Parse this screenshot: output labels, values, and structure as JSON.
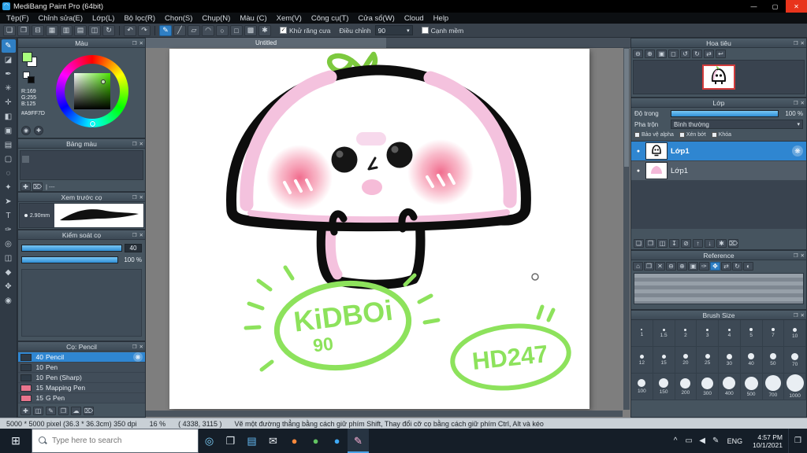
{
  "chrome": {
    "popout_glyph": "❐",
    "close_glyph": "✕",
    "dropdown_glyph": "▾",
    "check_glyph": "✓",
    "eye_glyph": "●",
    "gear_glyph": "❋",
    "accent_color": "#2f86d1"
  },
  "window": {
    "title": "MediBang Paint Pro (64bit)",
    "app_glyph": "◠",
    "minimize_glyph": "—",
    "maximize_glyph": "▢",
    "close_glyph": "✕"
  },
  "menu": {
    "items": [
      "Tệp(F)",
      "Chỉnh sửa(E)",
      "Lớp(L)",
      "Bộ lọc(R)",
      "Chọn(S)",
      "Chụp(N)",
      "Màu (C)",
      "Xem(V)",
      "Công cụ(T)",
      "Cửa sổ(W)",
      "Cloud",
      "Help"
    ]
  },
  "toolbar": {
    "file_icons": [
      {
        "name": "new-canvas-icon",
        "glyph": "❏"
      },
      {
        "name": "open-file-icon",
        "glyph": "❐"
      },
      {
        "name": "save-file-icon",
        "glyph": "⊟"
      },
      {
        "name": "grid-icon",
        "glyph": "▦"
      },
      {
        "name": "pixel-grid-icon",
        "glyph": "▥"
      },
      {
        "name": "material-panel-icon",
        "glyph": "▤"
      },
      {
        "name": "snap-settings-icon",
        "glyph": "◫"
      },
      {
        "name": "rotate-canvas-icon",
        "glyph": "↻"
      }
    ],
    "history_icons": [
      {
        "name": "undo-icon",
        "glyph": "↶"
      },
      {
        "name": "redo-icon",
        "glyph": "↷"
      }
    ],
    "mode_icons": [
      {
        "name": "brush-mode-icon",
        "glyph": "✎",
        "active": true
      },
      {
        "name": "straight-line-icon",
        "glyph": "╱"
      },
      {
        "name": "polyline-icon",
        "glyph": "▱"
      },
      {
        "name": "curve-icon",
        "glyph": "◠"
      },
      {
        "name": "ellipse-icon",
        "glyph": "○"
      },
      {
        "name": "rectangle-icon",
        "glyph": "□"
      },
      {
        "name": "fill-shape-icon",
        "glyph": "▩"
      },
      {
        "name": "stabilizer-icon",
        "glyph": "✱"
      }
    ],
    "antialias_label": "Khử răng cưa",
    "antialias_checked": true,
    "adjust_label": "Điều chỉnh",
    "adjust_value": "90",
    "soft_edge_label": "Cạnh mềm"
  },
  "tools": [
    {
      "name": "brush-tool-icon",
      "glyph": "✎",
      "active": true
    },
    {
      "name": "eraser-tool-icon",
      "glyph": "◪"
    },
    {
      "name": "pen-tool-icon",
      "glyph": "✒"
    },
    {
      "name": "airbrush-tool-icon",
      "glyph": "✳"
    },
    {
      "name": "move-tool-icon",
      "glyph": "✛"
    },
    {
      "name": "fill-tool-icon",
      "glyph": "◧"
    },
    {
      "name": "bucket-tool-icon",
      "glyph": "▣"
    },
    {
      "name": "gradient-tool-icon",
      "glyph": "▤"
    },
    {
      "name": "select-tool-icon",
      "glyph": "▢"
    },
    {
      "name": "lasso-tool-icon",
      "glyph": "◌"
    },
    {
      "name": "magic-wand-tool-icon",
      "glyph": "✦"
    },
    {
      "name": "select-pen-tool-icon",
      "glyph": "➤"
    },
    {
      "name": "text-tool-icon",
      "glyph": "T"
    },
    {
      "name": "eyedropper-tool-icon",
      "glyph": "✑"
    },
    {
      "name": "measure-tool-icon",
      "glyph": "◎"
    },
    {
      "name": "divide-tool-icon",
      "glyph": "◫"
    },
    {
      "name": "material-tool-icon",
      "glyph": "◆"
    },
    {
      "name": "hand-tool-icon",
      "glyph": "✥"
    },
    {
      "name": "zoom-tool-icon",
      "glyph": "◉"
    }
  ],
  "color_panel": {
    "title": "Màu",
    "r_label": "R:169",
    "g_label": "G:255",
    "b_label": "B:125",
    "hex_label": "#A9FF7D",
    "foreground_color": "#a9ff7d",
    "background_color": "#ffffff",
    "picker_icons": [
      {
        "name": "screen-picker-icon",
        "glyph": "◉"
      },
      {
        "name": "add-to-palette-icon",
        "glyph": "✚"
      }
    ]
  },
  "palette_panel": {
    "title": "Bảng màu",
    "footer_label": "| ---",
    "footer_icons": [
      {
        "name": "add-swatch-icon",
        "glyph": "✚"
      },
      {
        "name": "delete-swatch-icon",
        "glyph": "⌦"
      }
    ]
  },
  "brush_preview_panel": {
    "title": "Xem trước cọ",
    "size_label": "2.90mm"
  },
  "brush_control_panel": {
    "title": "Kiểm soát cọ",
    "size_value": "40",
    "opacity_value": "100 %"
  },
  "brush_list_panel": {
    "title": "Cọ: Pencil",
    "brushes": [
      {
        "size": "40",
        "name": "Pencil",
        "selected": true,
        "swatch": "#2f3b47"
      },
      {
        "size": "10",
        "name": "Pen",
        "swatch": "#2f3b47"
      },
      {
        "size": "10",
        "name": "Pen (Sharp)",
        "swatch": "#2f3b47"
      },
      {
        "size": "15",
        "name": "Mapping Pen",
        "swatch": "#e8758d"
      },
      {
        "size": "15",
        "name": "G Pen",
        "swatch": "#e8758d"
      }
    ],
    "footer_icons": [
      {
        "name": "add-brush-icon",
        "glyph": "✚"
      },
      {
        "name": "duplicate-brush-icon",
        "glyph": "◫"
      },
      {
        "name": "edit-brush-icon",
        "glyph": "✎"
      },
      {
        "name": "brush-folder-icon",
        "glyph": "❐"
      },
      {
        "name": "cloud-brush-icon",
        "glyph": "☁"
      },
      {
        "name": "delete-brush-icon",
        "glyph": "⌦"
      }
    ]
  },
  "canvas": {
    "tab_title": "Untitled",
    "doodle_text_line1": "KiDBOi",
    "doodle_text_line2": "90",
    "doodle_text_line3": "HD247",
    "doodle_color": "#8de25c"
  },
  "navigator_panel": {
    "title": "Hoa tiêu",
    "icons": [
      {
        "name": "zoom-out-icon",
        "glyph": "⊖"
      },
      {
        "name": "zoom-in-icon",
        "glyph": "⊕"
      },
      {
        "name": "fit-window-icon",
        "glyph": "▣"
      },
      {
        "name": "actual-pixels-icon",
        "glyph": "◻"
      },
      {
        "name": "rotate-left-icon",
        "glyph": "↺"
      },
      {
        "name": "rotate-right-icon",
        "glyph": "↻"
      },
      {
        "name": "flip-horizontal-icon",
        "glyph": "⇄"
      },
      {
        "name": "reset-view-icon",
        "glyph": "↩"
      }
    ]
  },
  "layer_panel": {
    "title": "Lớp",
    "opacity_label": "Độ trong",
    "opacity_value": "100 %",
    "blend_label": "Pha trộn",
    "blend_value": "Bình thường",
    "alpha_label": "Bảo vệ alpha",
    "clip_label": "Xén bớt",
    "lock_label": "Khóa",
    "layers": [
      {
        "name": "Lớp1",
        "selected": true
      },
      {
        "name": "Lớp1",
        "selected": false
      }
    ],
    "footer_icons": [
      {
        "name": "add-layer-icon",
        "glyph": "❏"
      },
      {
        "name": "add-folder-icon",
        "glyph": "❐"
      },
      {
        "name": "duplicate-layer-icon",
        "glyph": "◫"
      },
      {
        "name": "merge-down-icon",
        "glyph": "↧"
      },
      {
        "name": "clear-layer-icon",
        "glyph": "⊘"
      },
      {
        "name": "move-up-icon",
        "glyph": "↑"
      },
      {
        "name": "move-down-icon",
        "glyph": "↓"
      },
      {
        "name": "layer-settings-icon",
        "glyph": "✱"
      },
      {
        "name": "delete-layer-icon",
        "glyph": "⌦"
      }
    ]
  },
  "reference_panel": {
    "title": "Reference",
    "icons": [
      {
        "name": "home-icon",
        "glyph": "⌂"
      },
      {
        "name": "open-image-icon",
        "glyph": "❐"
      },
      {
        "name": "close-image-icon",
        "glyph": "✕"
      },
      {
        "name": "zoom-out-icon",
        "glyph": "⊖"
      },
      {
        "name": "zoom-in-icon",
        "glyph": "⊕"
      },
      {
        "name": "fit-icon",
        "glyph": "▣"
      },
      {
        "name": "eyedropper-icon",
        "glyph": "✑"
      },
      {
        "name": "hand-icon",
        "glyph": "✥",
        "active": true
      },
      {
        "name": "flip-icon",
        "glyph": "⇄"
      },
      {
        "name": "rotate-icon",
        "glyph": "↻"
      },
      {
        "name": "grayscale-icon",
        "glyph": "◐"
      }
    ]
  },
  "brush_size_panel": {
    "title": "Brush Size",
    "sizes": [
      "1",
      "1.5",
      "2",
      "3",
      "4",
      "5",
      "7",
      "10",
      "12",
      "15",
      "20",
      "25",
      "30",
      "40",
      "50",
      "70",
      "100",
      "150",
      "200",
      "300",
      "400",
      "500",
      "700",
      "1000"
    ]
  },
  "status_bar": {
    "doc_info": "5000 * 5000 pixel  (36.3 * 36.3cm)  350 dpi",
    "zoom": "16 %",
    "cursor_pos": "( 4338, 3115 )",
    "hint": "Vẽ một đường thẳng bằng cách giữ phím Shift, Thay đổi cỡ cọ bằng cách giữ phím Ctrl, Alt và kéo"
  },
  "taskbar": {
    "start_glyph": "⊞",
    "search_placeholder": "Type here to search",
    "app_icons": [
      {
        "name": "cortana-icon",
        "glyph": "◎",
        "color": "#7fd4ff"
      },
      {
        "name": "task-view-icon",
        "glyph": "❐",
        "color": "#e3eaf0"
      },
      {
        "name": "store-icon",
        "glyph": "▤",
        "color": "#64b9f2"
      },
      {
        "name": "mail-icon",
        "glyph": "✉",
        "color": "#e9eef3"
      },
      {
        "name": "firefox-icon",
        "glyph": "●",
        "color": "#ff8a3c"
      },
      {
        "name": "chrome-icon",
        "glyph": "●",
        "color": "#62c462"
      },
      {
        "name": "edge-icon",
        "glyph": "●",
        "color": "#3fa9f5"
      },
      {
        "name": "medibang-taskbar-icon",
        "glyph": "✎",
        "color": "#ffb3d9",
        "active": true
      }
    ],
    "tray_icons": [
      {
        "name": "tray-expand-icon",
        "glyph": "^"
      },
      {
        "name": "network-icon",
        "glyph": "▭"
      },
      {
        "name": "volume-icon",
        "glyph": "◀"
      },
      {
        "name": "pen-input-icon",
        "glyph": "✎"
      }
    ],
    "language": "ENG",
    "time": "4:57 PM",
    "date": "10/1/2021",
    "action_glyph": "❒"
  }
}
